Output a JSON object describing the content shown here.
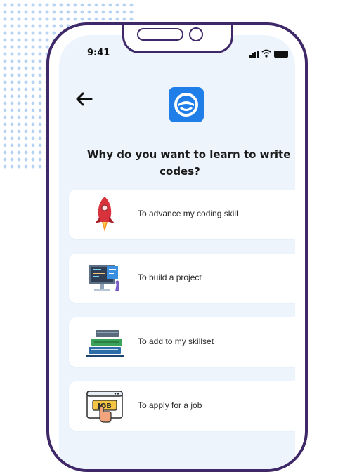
{
  "status_bar": {
    "time": "9:41"
  },
  "header": {
    "back_icon": "back-arrow-icon",
    "logo_icon": "app-logo-icon",
    "accent": "#1f7ee8"
  },
  "question": {
    "line1": "Why do you want to learn to write",
    "line2": "codes?"
  },
  "options": [
    {
      "label": "To advance my coding skill",
      "icon": "rocket-icon"
    },
    {
      "label": "To build a project",
      "icon": "computer-code-icon"
    },
    {
      "label": "To add to my skillset",
      "icon": "books-icon"
    },
    {
      "label": "To apply for a job",
      "icon": "job-click-icon"
    }
  ],
  "colors": {
    "phone_frame": "#3e2868",
    "screen_bg": "#eef4fc",
    "card_bg": "#ffffff"
  }
}
